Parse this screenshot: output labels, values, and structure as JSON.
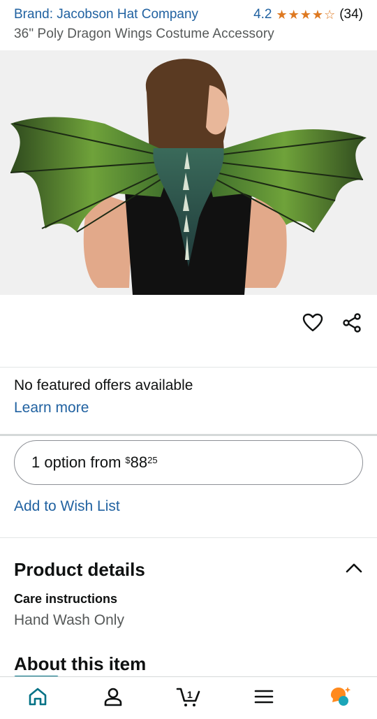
{
  "product": {
    "brand": "Brand: Jacobson Hat Company",
    "rating": "4.2",
    "stars_filled": 4,
    "review_count": "(34)",
    "title": "36\" Poly Dragon Wings Costume Accessory"
  },
  "offers": {
    "no_featured": "No featured offers available",
    "learn_more": "Learn more"
  },
  "option": {
    "label": "1 option from",
    "price_symbol": "$",
    "price_whole": "88",
    "price_fraction": "25"
  },
  "wishlist": "Add to Wish List",
  "details": {
    "title": "Product details",
    "care_label": "Care instructions",
    "care_value": "Hand Wash Only"
  },
  "about": "About this item",
  "nav": {
    "cart_count": "1",
    "icons": [
      "home-icon",
      "account-icon",
      "cart-icon",
      "menu-icon",
      "rufus-assistant-icon"
    ]
  },
  "colors": {
    "link": "#2162a1",
    "star": "#de7921",
    "accent_teal": "#007185",
    "ai_orange": "#ff8a1e"
  }
}
